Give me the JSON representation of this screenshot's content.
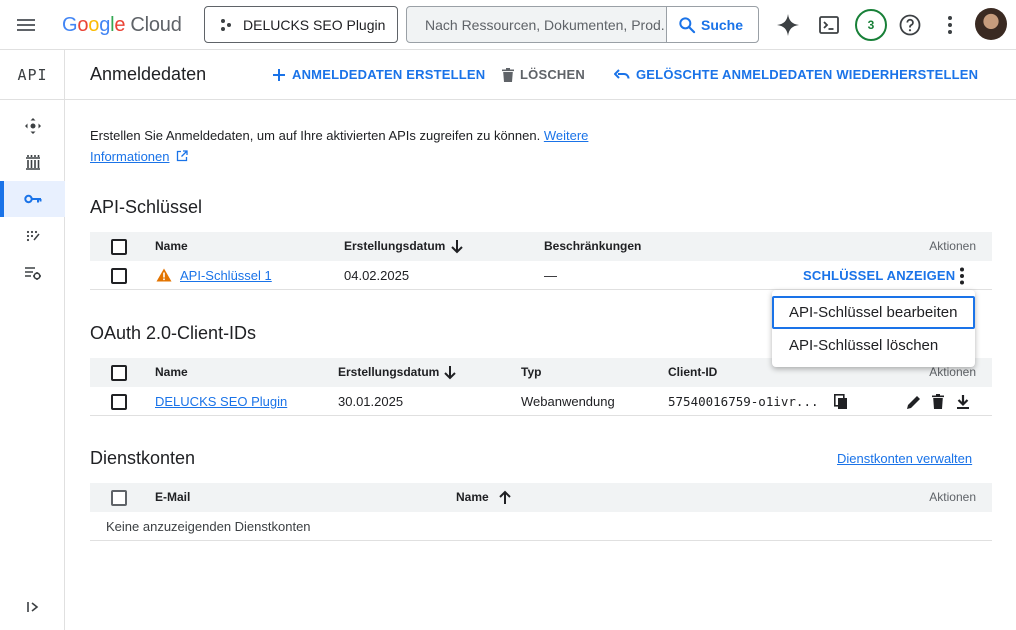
{
  "topbar": {
    "logo_google": [
      "G",
      "o",
      "o",
      "g",
      "l",
      "e"
    ],
    "logo_cloud": "Cloud",
    "project_name": "DELUCKS SEO Plugin",
    "search_placeholder": "Nach Ressourcen, Dokumenten, Prod...",
    "search_button": "Suche",
    "notifications_count": "3"
  },
  "rail": {
    "api_label": "API"
  },
  "header": {
    "title": "Anmeldedaten",
    "create_label": "ANMELDEDATEN ERSTELLEN",
    "delete_label": "LÖSCHEN",
    "restore_label": "GELÖSCHTE ANMELDEDATEN WIEDERHERSTELLEN"
  },
  "intro": {
    "text": "Erstellen Sie Anmeldedaten, um auf Ihre aktivierten APIs zugreifen zu können.",
    "link_part1": "Weitere",
    "link_part2": "Informationen"
  },
  "api_keys": {
    "title": "API-Schlüssel",
    "columns": {
      "name": "Name",
      "created": "Erstellungsdatum",
      "restrictions": "Beschränkungen",
      "actions": "Aktionen"
    },
    "rows": [
      {
        "name": "API-Schlüssel 1",
        "created": "04.02.2025",
        "restrictions": "—",
        "action": "SCHLÜSSEL ANZEIGEN"
      }
    ]
  },
  "menu": {
    "items": [
      "API-Schlüssel bearbeiten",
      "API-Schlüssel löschen"
    ]
  },
  "oauth": {
    "title": "OAuth 2.0-Client-IDs",
    "columns": {
      "name": "Name",
      "created": "Erstellungsdatum",
      "type": "Typ",
      "client_id": "Client-ID",
      "actions": "Aktionen"
    },
    "rows": [
      {
        "name": "DELUCKS SEO Plugin",
        "created": "30.01.2025",
        "type": "Webanwendung",
        "client_id": "57540016759-o1ivr..."
      }
    ]
  },
  "service_accounts": {
    "title": "Dienstkonten",
    "manage_link": "Dienstkonten verwalten",
    "columns": {
      "email": "E-Mail",
      "name": "Name",
      "actions": "Aktionen"
    },
    "empty_text": "Keine anzuzeigenden Dienstkonten"
  },
  "colors": {
    "accent": "#1a73e8",
    "warning": "#e37400",
    "success": "#188038"
  },
  "icons": [
    "menu-icon",
    "project-icon",
    "search-icon",
    "gemini-icon",
    "terminal-icon",
    "help-icon",
    "more-vert-icon",
    "api-icon",
    "dashboard-icon",
    "library-icon",
    "key-icon",
    "oauth-icon",
    "settings-list-icon",
    "expand-icon",
    "add-icon",
    "trash-icon",
    "undo-icon",
    "external-link-icon",
    "arrow-down-icon",
    "arrow-up-icon",
    "warning-icon",
    "copy-icon",
    "edit-icon",
    "download-icon"
  ]
}
